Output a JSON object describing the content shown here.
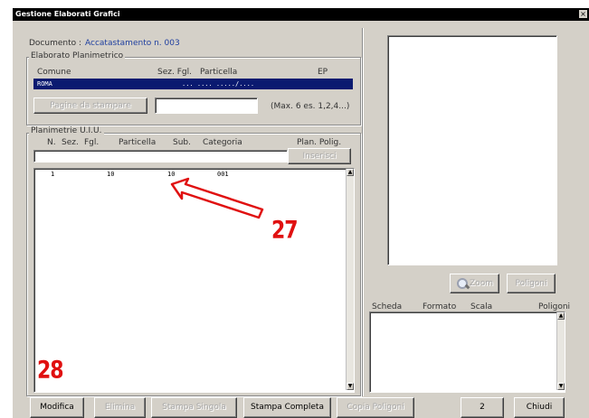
{
  "window": {
    "title": "Gestione Elaborati Grafici",
    "close_glyph": "×"
  },
  "documento": {
    "label": "Documento :",
    "value": "Accatastamento n. 003"
  },
  "elaborato": {
    "group_title": "Elaborato Planimetrico",
    "columns": [
      "Comune",
      "Sez. Fgl.",
      "Particella",
      "EP"
    ],
    "row": {
      "comune": "ROMA",
      "sez_fgl_particella": "... ....  ...../....",
      "ep": ""
    },
    "pagine_button": "Pagine da stampare",
    "pagine_value": "",
    "hint": "(Max. 6 es. 1,2,4...)"
  },
  "planimetrie": {
    "group_title": "Planimetrie U.I.U.",
    "columns": [
      "N.",
      "Sez.",
      "Fgl.",
      "Particella",
      "Sub.",
      "Categoria",
      "Plan. Polig."
    ],
    "input_value": "",
    "inserisci_button": "Inserisci",
    "rows": [
      {
        "n": "1",
        "sez": "",
        "fgl": "10",
        "particella": "10",
        "sub": "001",
        "categoria": ""
      }
    ]
  },
  "preview": {
    "zoom_button": "Zoom",
    "poligoni_button": "Poligoni",
    "zoom_icon": "magnifier-icon",
    "columns": [
      "Scheda",
      "Formato",
      "Scala",
      "Poligoni"
    ]
  },
  "footer": {
    "buttons": [
      {
        "label": "Modifica",
        "enabled": true
      },
      {
        "label": "Elimina",
        "enabled": false
      },
      {
        "label": "Stampa Singola",
        "enabled": false
      },
      {
        "label": "Stampa Completa",
        "enabled": true
      },
      {
        "label": "Copia Poligoni",
        "enabled": false
      }
    ],
    "count": "2",
    "chiudi_button": "Chiudi"
  },
  "annotations": {
    "arrow_label": "27",
    "corner_label": "28",
    "color": "#e01010"
  },
  "colors": {
    "selection": "#0a1a70",
    "window_bg": "#d4d0c8",
    "link_blue": "#2040a0"
  }
}
